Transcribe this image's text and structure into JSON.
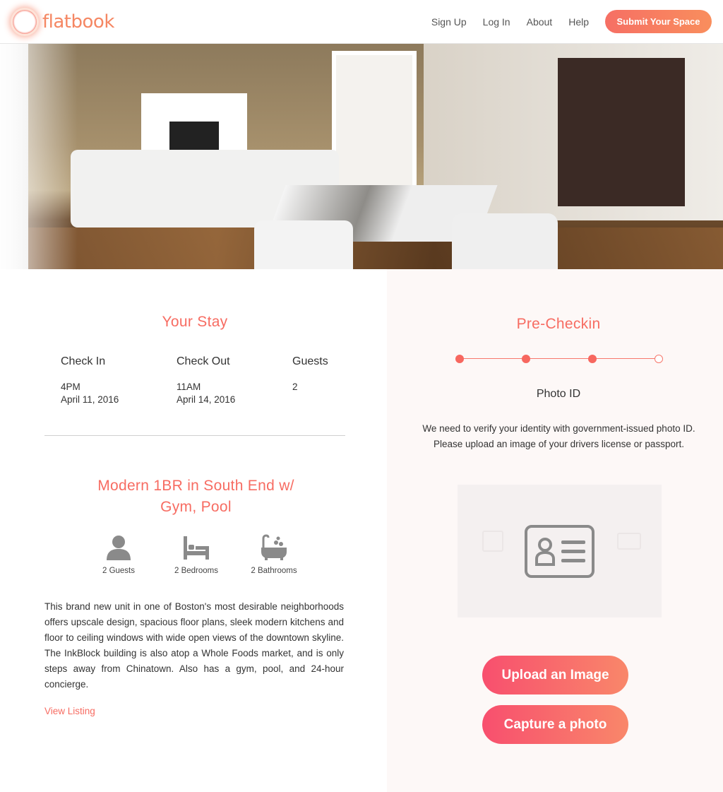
{
  "header": {
    "logo_text": "flatbook",
    "nav": [
      "Sign Up",
      "Log In",
      "About",
      "Help"
    ],
    "submit_label": "Submit Your Space"
  },
  "stay": {
    "title": "Your Stay",
    "check_in_label": "Check In",
    "check_in_time": "4PM",
    "check_in_date": "April 11, 2016",
    "check_out_label": "Check Out",
    "check_out_time": "11AM",
    "check_out_date": "April 14, 2016",
    "guests_label": "Guests",
    "guests_value": "2"
  },
  "listing": {
    "title": "Modern 1BR in South End w/ Gym, Pool",
    "amenities": [
      {
        "icon": "person-icon",
        "label": "2 Guests"
      },
      {
        "icon": "bed-icon",
        "label": "2 Bedrooms"
      },
      {
        "icon": "bathtub-icon",
        "label": "2 Bathrooms"
      }
    ],
    "description": "This brand new unit in one of Boston's most desirable neighborhoods offers upscale design, spacious floor plans, sleek modern kitchens and floor to ceiling windows with wide open views of the downtown skyline. The InkBlock building is also atop a Whole Foods market, and is only steps away from Chinatown. Also has a gym, pool, and 24-hour concierge.",
    "view_link": "View Listing"
  },
  "precheckin": {
    "title": "Pre-Checkin",
    "steps_total": 4,
    "steps_completed": 3,
    "step_name": "Photo ID",
    "step_description": "We need to verify your identity with government-issued photo ID. Please upload an image of your drivers license or passport.",
    "upload_label": "Upload an Image",
    "capture_label": "Capture a photo"
  },
  "colors": {
    "accent": "#f76c62",
    "button_gradient_start": "#f84f6e",
    "button_gradient_end": "#f9876a",
    "panel_bg": "#fdf8f7"
  }
}
